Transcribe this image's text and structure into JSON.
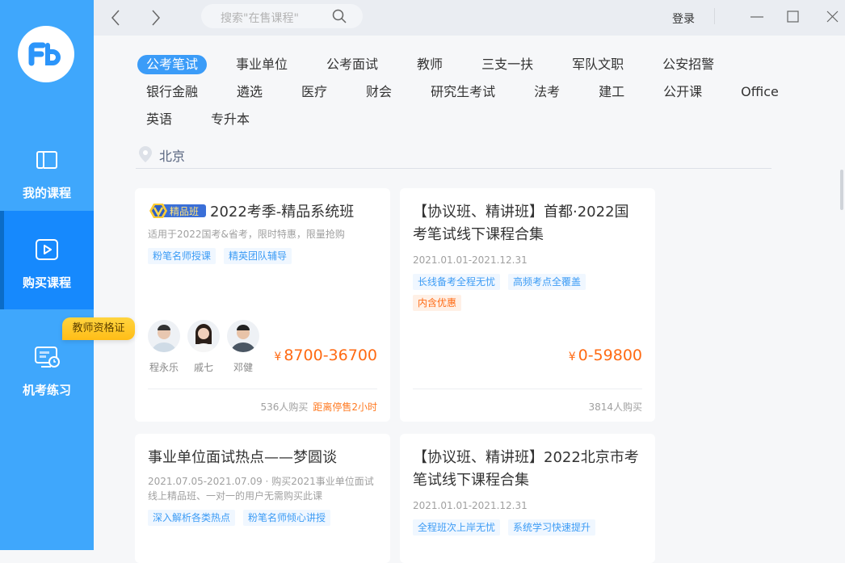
{
  "sidebar": {
    "items": [
      {
        "label": "我的课程",
        "icon": "book-icon"
      },
      {
        "label": "购买课程",
        "icon": "play-icon",
        "active": true
      },
      {
        "label": "机考练习",
        "icon": "monitor-clock-icon"
      }
    ],
    "tooltip": "教师资格证"
  },
  "topbar": {
    "search_placeholder": "搜索\"在售课程\"",
    "login": "登录"
  },
  "categories": {
    "rows": [
      [
        "公考笔试",
        "事业单位",
        "公考面试",
        "教师",
        "三支一扶",
        "军队文职",
        "公安招警"
      ],
      [
        "银行金融",
        "遴选",
        "医疗",
        "财会",
        "研究生考试",
        "法考",
        "建工",
        "公开课",
        "Office"
      ],
      [
        "英语",
        "专升本"
      ]
    ],
    "active": "公考笔试"
  },
  "location": "北京",
  "cards": [
    {
      "badge": "精品班",
      "title": "2022考季-精品系统班",
      "subtitle": "适用于2022国考&省考，限时特惠，限量抢购",
      "tags": [
        "粉笔名师授课",
        "精英团队辅导"
      ],
      "teachers": [
        "程永乐",
        "戚七",
        "邓健"
      ],
      "currency": "¥",
      "price": "8700-36700",
      "buyers": "536人购买",
      "deadline": "距离停售2小时"
    },
    {
      "title": "【协议班、精讲班】首都·2022国考笔试线下课程合集",
      "subtitle": "2021.01.01-2021.12.31",
      "tags": [
        "长线备考全程无忧",
        "高频考点全覆盖"
      ],
      "tag_orange": "内含优惠",
      "currency": "¥",
      "price": "0-59800",
      "buyers": "3814人购买"
    },
    {
      "title": "事业单位面试热点——梦圆谈",
      "subtitle": "2021.07.05-2021.07.09 · 购买2021事业单位面试线上精品班、一对一的用户无需购买此课",
      "tags": [
        "深入解析各类热点",
        "粉笔名师倾心讲授"
      ]
    },
    {
      "title": "【协议班、精讲班】2022北京市考笔试线下课程合集",
      "subtitle": "2021.01.01-2021.12.31",
      "tags": [
        "全程班次上岸无忧",
        "系统学习快速提升"
      ]
    }
  ],
  "colors": {
    "sidebar": "#3fa7fc",
    "active": "#1689fd",
    "accent": "#3b9cf8",
    "price": "#ff6a13"
  }
}
